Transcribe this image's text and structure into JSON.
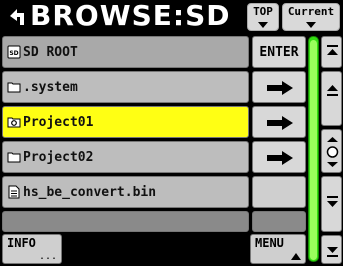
{
  "header": {
    "title": "BROWSE:SD",
    "top_label": "TOP",
    "current_label": "Current"
  },
  "list": {
    "root_label": "SD ROOT",
    "enter_label": "ENTER",
    "items": [
      {
        "name": ".system",
        "type": "folder"
      },
      {
        "name": "Project01",
        "type": "project",
        "selected": true
      },
      {
        "name": "Project02",
        "type": "folder"
      },
      {
        "name": "hs_be_convert.bin",
        "type": "file"
      }
    ]
  },
  "footer": {
    "info_label": "INFO",
    "info_more": "...",
    "menu_label": "MENU"
  },
  "colors": {
    "selected_row": "#ffff14",
    "scrollbar": "#33dd11"
  }
}
